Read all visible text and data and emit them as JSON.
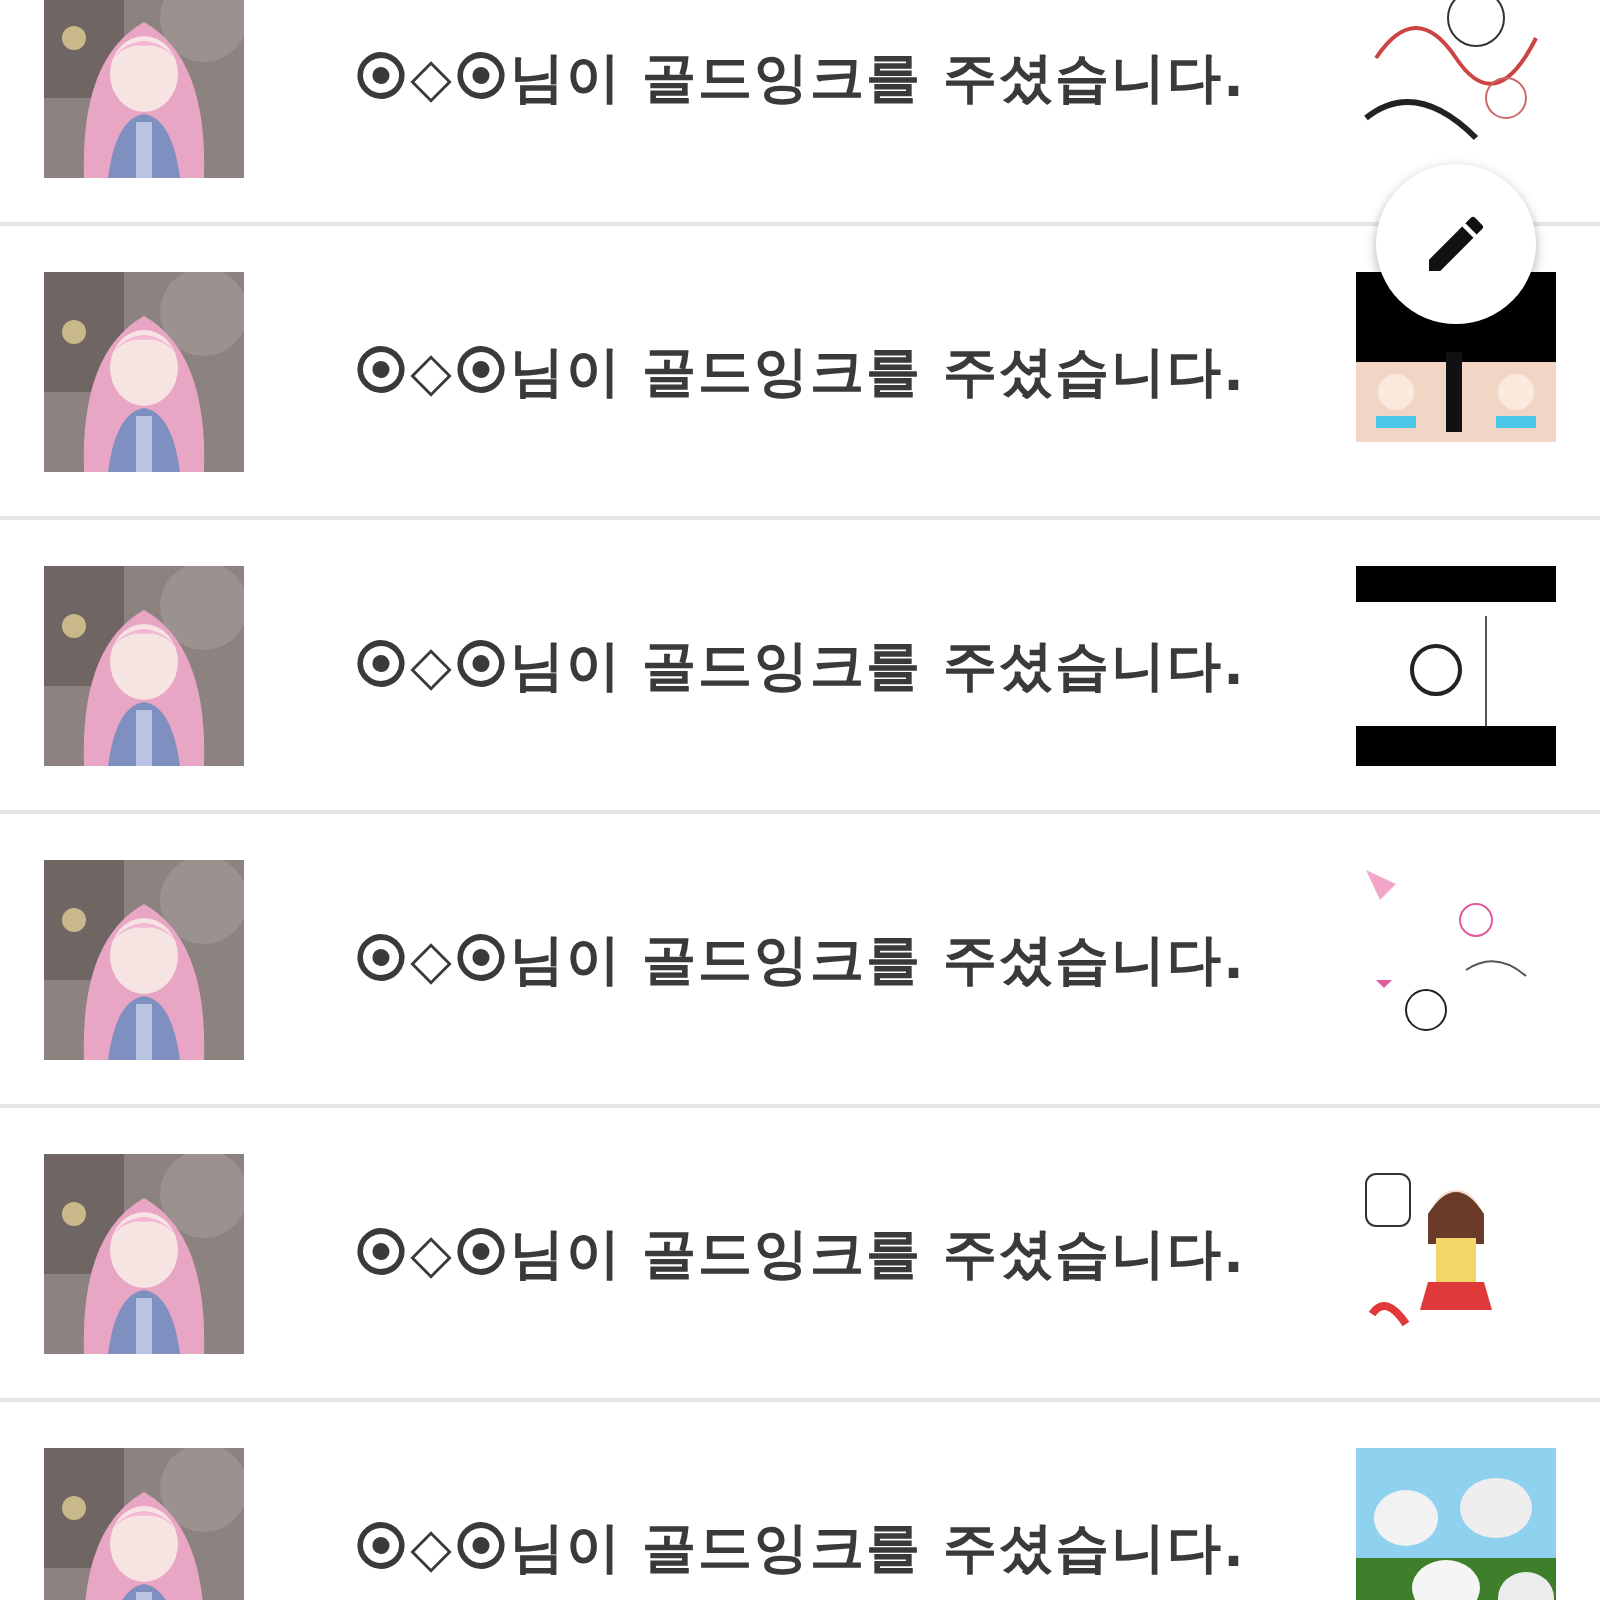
{
  "notifications": [
    {
      "message": "⦿◇⦿님이 골드잉크를 주셨습니다."
    },
    {
      "message": "⦿◇⦿님이 골드잉크를 주셨습니다."
    },
    {
      "message": "⦿◇⦿님이 골드잉크를 주셨습니다."
    },
    {
      "message": "⦿◇⦿님이 골드잉크를 주셨습니다."
    },
    {
      "message": "⦿◇⦿님이 골드잉크를 주셨습니다."
    },
    {
      "message": "⦿◇⦿님이 골드잉크를 주셨습니다."
    }
  ]
}
